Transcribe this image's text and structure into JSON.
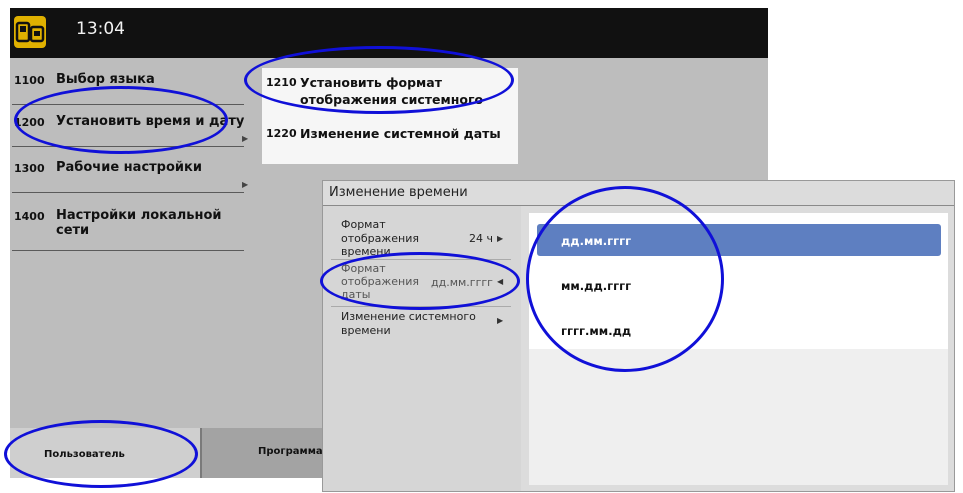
{
  "header": {
    "time": "13:04"
  },
  "menu": {
    "items": [
      {
        "number": "1100",
        "label": "Выбор языка"
      },
      {
        "number": "1200",
        "label": "Установить время и дату"
      },
      {
        "number": "1300",
        "label": "Рабочие настройки"
      },
      {
        "number": "1400",
        "label": "Настройки локальной сети"
      }
    ]
  },
  "submenu": {
    "items": [
      {
        "number": "1210",
        "label_line1": "Установить формат",
        "label_line2": "отображения системного"
      },
      {
        "number": "1220",
        "label": "Изменение системной даты"
      }
    ]
  },
  "bottom_tabs": {
    "user": "Пользователь",
    "program": "Программа"
  },
  "dialog": {
    "title": "Изменение времени",
    "settings": [
      {
        "label_line1": "Формат",
        "label_line2": "отображения",
        "label_line3": "времени",
        "value": "24 ч"
      },
      {
        "label_line1": "Формат",
        "label_line2": "отображения",
        "label_line3": "даты",
        "value": "дд.мм.гггг"
      },
      {
        "label_line1": "Изменение системного",
        "label_line2": "времени"
      }
    ],
    "options": [
      "дд.мм.гггг",
      "мм.дд.гггг",
      "гггг.мм.дд"
    ],
    "selected_option": "дд.мм.гггг"
  },
  "colors": {
    "highlight_oval": "#1010d8",
    "selected_option_bg": "#5e7fc1",
    "top_bar": "#111111"
  },
  "icons": {
    "app": "device-app-icon",
    "arrow": "triangle-right-icon",
    "arrow_left": "triangle-left-icon"
  }
}
